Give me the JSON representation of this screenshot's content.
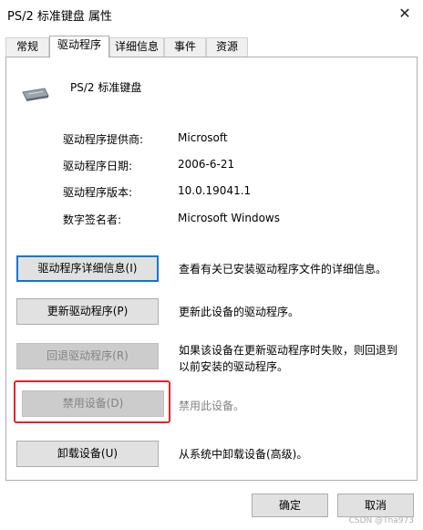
{
  "window": {
    "title": "PS/2 标准键盘 属性",
    "close_glyph": "✕"
  },
  "tabs": [
    {
      "label": "常规"
    },
    {
      "label": "驱动程序"
    },
    {
      "label": "详细信息"
    },
    {
      "label": "事件"
    },
    {
      "label": "资源"
    }
  ],
  "device": {
    "icon": "keyboard-icon",
    "name": "PS/2 标准键盘"
  },
  "info": [
    {
      "label": "驱动程序提供商:",
      "value": "Microsoft"
    },
    {
      "label": "驱动程序日期:",
      "value": "2006-6-21"
    },
    {
      "label": "驱动程序版本:",
      "value": "10.0.19041.1"
    },
    {
      "label": "数字签名者:",
      "value": "Microsoft Windows"
    }
  ],
  "actions": [
    {
      "label": "驱动程序详细信息(I)",
      "description": "查看有关已安装驱动程序文件的详细信息。",
      "enabled": true
    },
    {
      "label": "更新驱动程序(P)",
      "description": "更新此设备的驱动程序。",
      "enabled": true
    },
    {
      "label": "回退驱动程序(R)",
      "description": "如果该设备在更新驱动程序时失败，则回退到以前安装的驱动程序。",
      "enabled": false
    },
    {
      "label": "禁用设备(D)",
      "description": "禁用此设备。",
      "enabled": false
    },
    {
      "label": "卸载设备(U)",
      "description": "从系统中卸载设备(高级)。",
      "enabled": true
    }
  ],
  "footer": {
    "ok_label": "确定",
    "cancel_label": "取消"
  },
  "watermark": "CSDN @Tha973",
  "colors": {
    "highlight": "#e0252b",
    "focus": "#0078d7"
  }
}
